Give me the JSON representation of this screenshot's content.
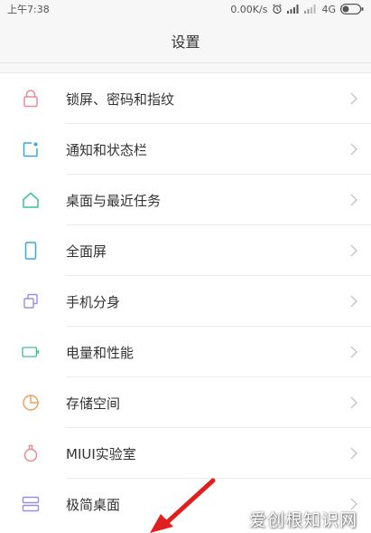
{
  "status": {
    "time": "上午7:38",
    "speed": "0.00K/s",
    "network": "4G"
  },
  "header": {
    "title": "设置"
  },
  "items": [
    {
      "label": "锁屏、密码和指纹",
      "icon": "lock-icon",
      "color": "#e68a9a"
    },
    {
      "label": "通知和状态栏",
      "icon": "notification-icon",
      "color": "#3aa6dd"
    },
    {
      "label": "桌面与最近任务",
      "icon": "home-icon",
      "color": "#3cc48f"
    },
    {
      "label": "全面屏",
      "icon": "phone-icon",
      "color": "#3aa6dd"
    },
    {
      "label": "手机分身",
      "icon": "copy-icon",
      "color": "#9b8ee0"
    },
    {
      "label": "电量和性能",
      "icon": "battery-icon",
      "color": "#3cc48f"
    },
    {
      "label": "存储空间",
      "icon": "pie-chart-icon",
      "color": "#f0a05a"
    },
    {
      "label": "MIUI实验室",
      "icon": "flask-icon",
      "color": "#e68a9a"
    },
    {
      "label": "极简桌面",
      "icon": "layout-icon",
      "color": "#9b8ee0"
    }
  ],
  "watermark": "爱创根知识网",
  "accent": {
    "arrow": "#e02020",
    "chevron": "#c4c4c4"
  }
}
